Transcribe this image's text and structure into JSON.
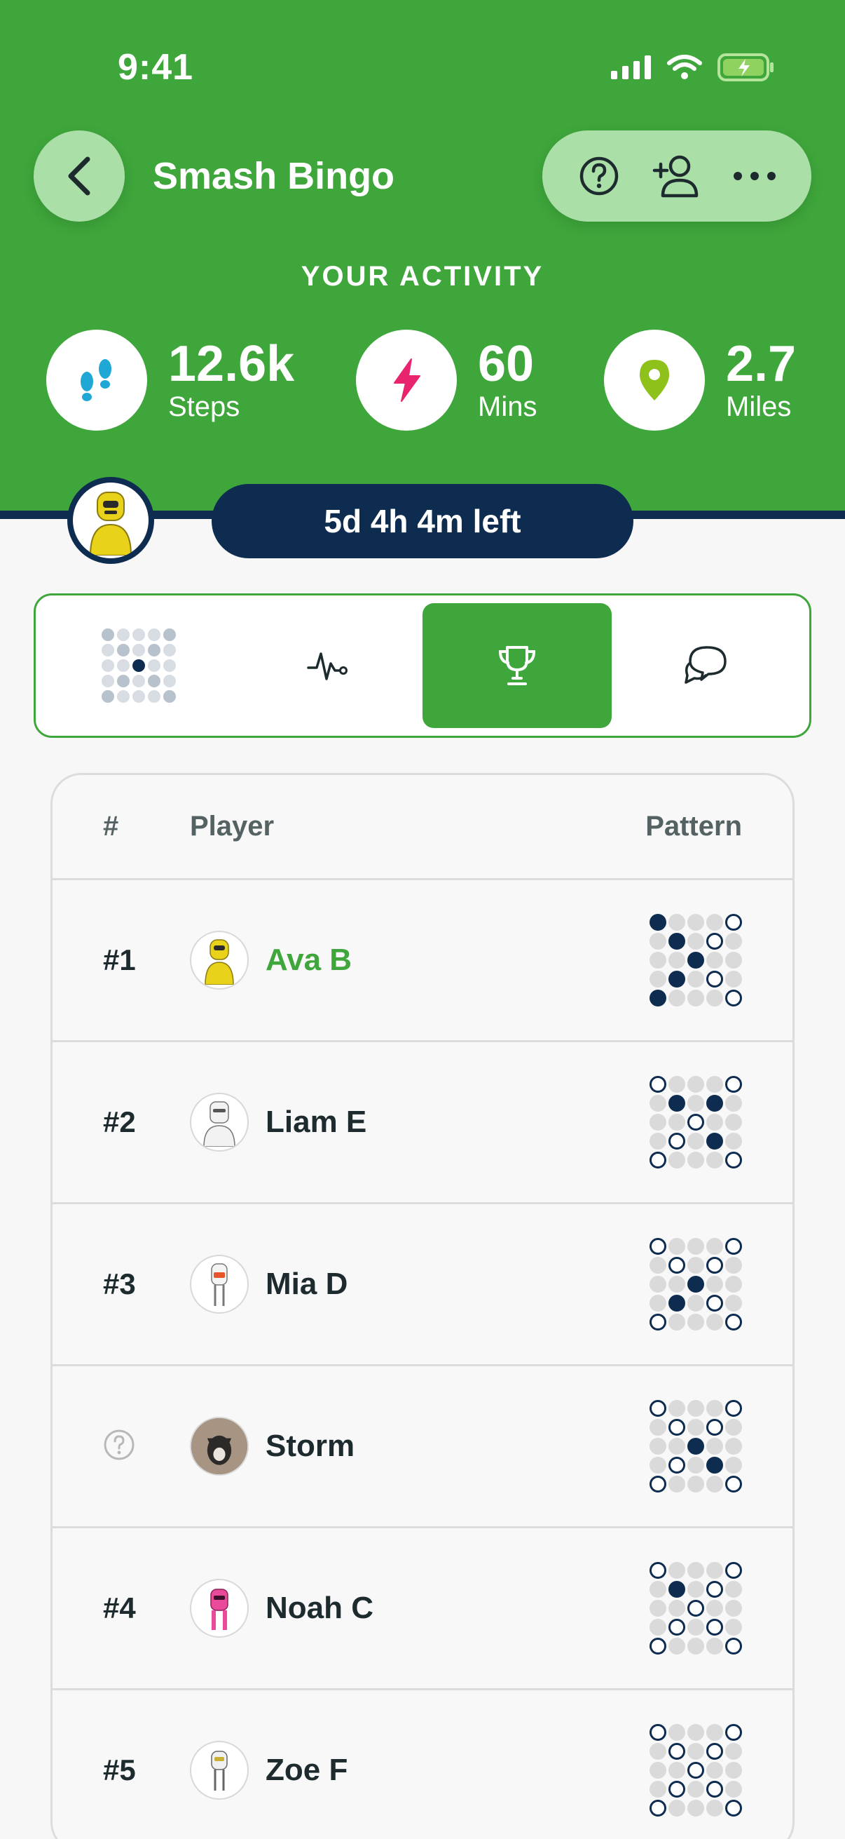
{
  "status_bar": {
    "time": "9:41"
  },
  "header": {
    "title": "Smash Bingo",
    "activity_label": "YOUR ACTIVITY",
    "stats": [
      {
        "value": "12.6k",
        "unit": "Steps",
        "icon": "footsteps-icon",
        "color": "#1fa8d6"
      },
      {
        "value": "60",
        "unit": "Mins",
        "icon": "lightning-icon",
        "color": "#e8246e"
      },
      {
        "value": "2.7",
        "unit": "Miles",
        "icon": "location-pin-icon",
        "color": "#8ec21a"
      }
    ],
    "time_left": "5d 4h 4m left"
  },
  "tabs": [
    {
      "name": "tab-bingo-card",
      "icon": "bingo-grid-icon",
      "active": false
    },
    {
      "name": "tab-activity",
      "icon": "pulse-icon",
      "active": false
    },
    {
      "name": "tab-leaderboard",
      "icon": "trophy-icon",
      "active": true
    },
    {
      "name": "tab-chat",
      "icon": "chat-bubbles-icon",
      "active": false
    }
  ],
  "leaderboard": {
    "headers": {
      "rank": "#",
      "player": "Player",
      "pattern": "Pattern"
    },
    "rows": [
      {
        "rank": "#1",
        "name": "Ava B",
        "is_me": true,
        "pattern": [
          "f...o",
          ".f.o.",
          "..f..",
          ".f.o.",
          "f...o"
        ]
      },
      {
        "rank": "#2",
        "name": "Liam E",
        "is_me": false,
        "pattern": [
          "o...o",
          ".f.f.",
          "..o..",
          ".o.f.",
          "o...o"
        ]
      },
      {
        "rank": "#3",
        "name": "Mia D",
        "is_me": false,
        "pattern": [
          "o...o",
          ".o.o.",
          "..f..",
          ".f.o.",
          "o...o"
        ]
      },
      {
        "rank": "?",
        "name": "Storm",
        "is_me": false,
        "pattern": [
          "o...o",
          ".o.o.",
          "..f..",
          ".o.f.",
          "o...o"
        ]
      },
      {
        "rank": "#4",
        "name": "Noah C",
        "is_me": false,
        "pattern": [
          "o...o",
          ".f.o.",
          "..o..",
          ".o.o.",
          "o...o"
        ]
      },
      {
        "rank": "#5",
        "name": "Zoe F",
        "is_me": false,
        "pattern": [
          "o...o",
          ".o.o.",
          "..o..",
          ".o.o.",
          "o...o"
        ]
      }
    ]
  },
  "colors": {
    "brand_green": "#3ea63b",
    "navy": "#0d2c50",
    "light_green": "#abdfa8"
  }
}
